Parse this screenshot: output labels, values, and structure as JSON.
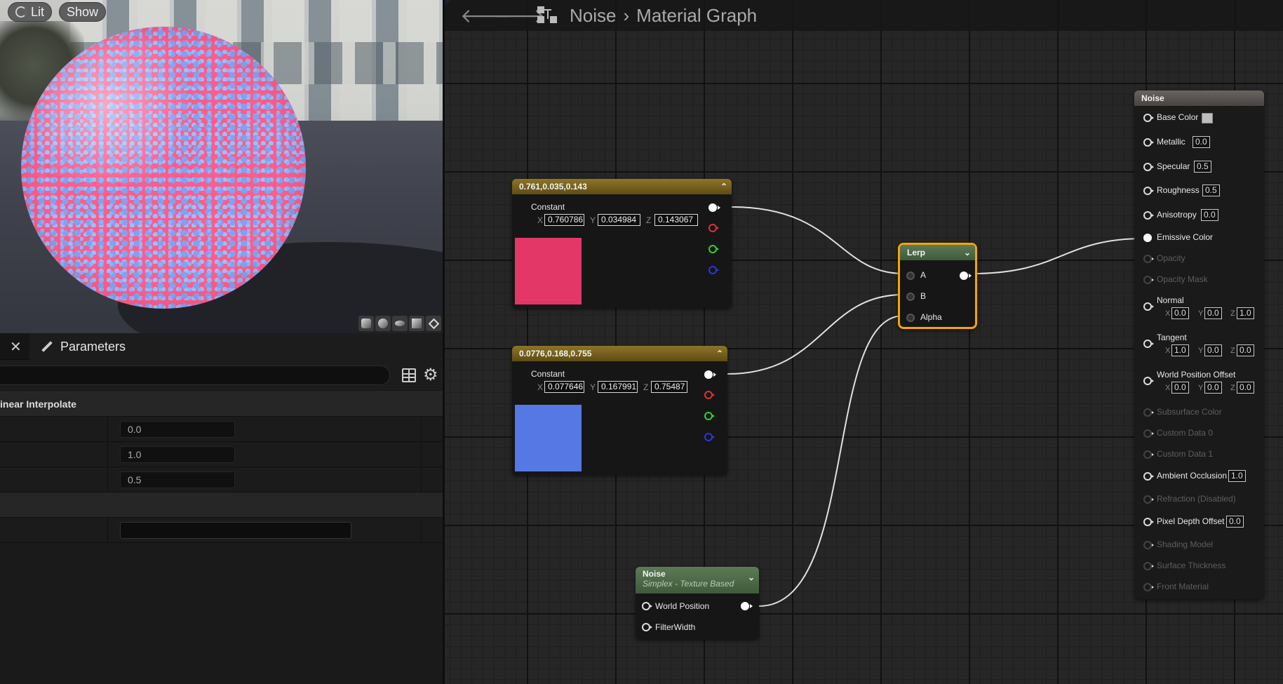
{
  "viewport": {
    "lit_label": "Lit",
    "show_label": "Show"
  },
  "params_panel": {
    "tab_label": "Parameters",
    "search_placeholder": "",
    "section_title": "inear Interpolate",
    "rows": [
      {
        "value": "0.0"
      },
      {
        "value": "1.0"
      },
      {
        "value": "0.5"
      }
    ]
  },
  "graph": {
    "breadcrumb": [
      "Noise",
      "Material Graph"
    ],
    "nodes": {
      "const1": {
        "title": "0.761,0.035,0.143",
        "subtitle": "Constant",
        "x_label": "X",
        "y_label": "Y",
        "z_label": "Z",
        "x": "0.760786",
        "y": "0.034984",
        "z": "0.143067",
        "color": "#E33768"
      },
      "const2": {
        "title": "0.0776,0.168,0.755",
        "subtitle": "Constant",
        "x_label": "X",
        "y_label": "Y",
        "z_label": "Z",
        "x": "0.077646",
        "y": "0.167991",
        "z": "0.75487",
        "color": "#5678E5"
      },
      "lerp": {
        "title": "Lerp",
        "pins": [
          "A",
          "B",
          "Alpha"
        ]
      },
      "noise": {
        "title": "Noise",
        "subtitle": "Simplex - Texture Based",
        "pins": [
          "World Position",
          "FilterWidth"
        ]
      },
      "result": {
        "title": "Noise",
        "base_color": "Base Color",
        "metallic": "Metallic",
        "metallic_val": "0.0",
        "specular": "Specular",
        "specular_val": "0.5",
        "roughness": "Roughness",
        "roughness_val": "0.5",
        "anisotropy": "Anisotropy",
        "anisotropy_val": "0.0",
        "emissive": "Emissive Color",
        "opacity": "Opacity",
        "opacity_mask": "Opacity Mask",
        "normal": "Normal",
        "normal_x": "0.0",
        "normal_y": "0.0",
        "normal_z": "1.0",
        "tangent": "Tangent",
        "tangent_x": "1.0",
        "tangent_y": "0.0",
        "tangent_z": "0.0",
        "wpo": "World Position Offset",
        "wpo_x": "0.0",
        "wpo_y": "0.0",
        "wpo_z": "0.0",
        "subsurface": "Subsurface Color",
        "custom0": "Custom Data 0",
        "custom1": "Custom Data 1",
        "ao": "Ambient Occlusion",
        "ao_val": "1.0",
        "refraction": "Refraction (Disabled)",
        "pdo": "Pixel Depth Offset",
        "pdo_val": "0.0",
        "shading": "Shading Model",
        "thickness": "Surface Thickness",
        "front": "Front Material",
        "x_label": "X",
        "y_label": "Y",
        "z_label": "Z"
      }
    }
  },
  "colors": {
    "wire": "#e0e0e0",
    "lerp_border": "#f5a500",
    "accent_blue": "#1c74e8"
  }
}
